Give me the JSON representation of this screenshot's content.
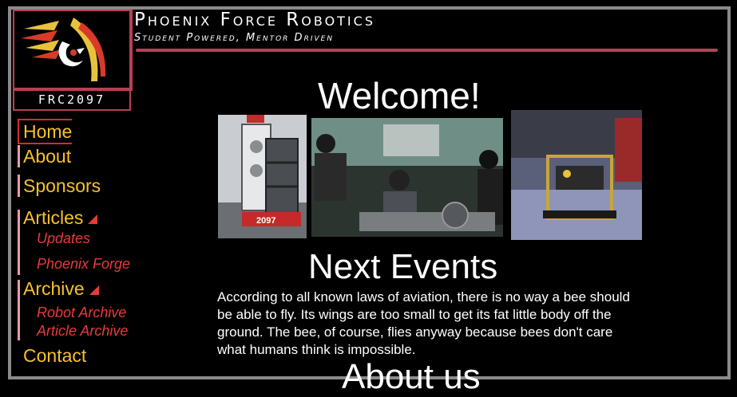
{
  "header": {
    "team_number": "FRC2097",
    "title": "Phoenix Force Robotics",
    "tagline": "Student Powered, Mentor Driven"
  },
  "nav": {
    "items": [
      {
        "label": "Home",
        "active": true
      },
      {
        "label": "About"
      },
      {
        "label": "Sponsors"
      },
      {
        "label": "Articles",
        "sub": [
          "Updates",
          "Phoenix Forge"
        ]
      },
      {
        "label": "Archive",
        "sub": [
          "Robot Archive",
          "Article Archive"
        ]
      },
      {
        "label": "Contact"
      }
    ]
  },
  "main": {
    "welcome_heading": "Welcome!",
    "next_events_heading": "Next Events",
    "next_events_text": "According to all known laws of aviation, there is no way a bee should be able to fly. Its wings are too small to get its fat little body off the ground. The bee, of course, flies anyway because bees don't care what humans think is impossible.",
    "about_heading": "About us"
  },
  "photo_text": {
    "robot_bumper": "2097"
  },
  "colors": {
    "accent": "#b64055",
    "nav_text": "#f7c12a",
    "sub_nav_text": "#e83a3a",
    "frame": "#8a8a8a"
  }
}
